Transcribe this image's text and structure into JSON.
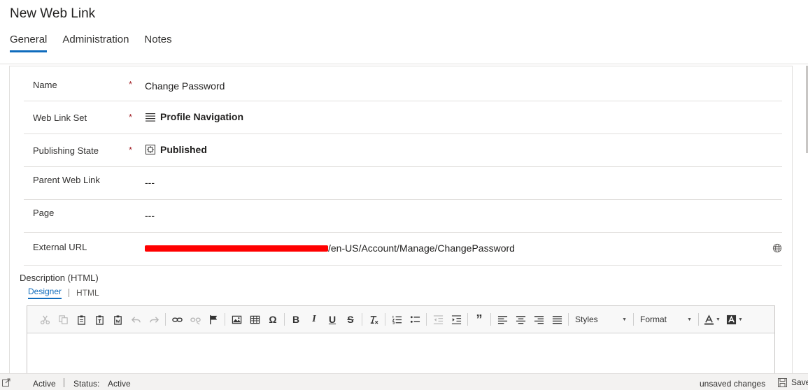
{
  "header": {
    "title": "New Web Link",
    "tabs": [
      {
        "label": "General",
        "active": true
      },
      {
        "label": "Administration",
        "active": false
      },
      {
        "label": "Notes",
        "active": false
      }
    ]
  },
  "form": {
    "fields": [
      {
        "label": "Name",
        "required": "*",
        "value": "Change Password"
      },
      {
        "label": "Web Link Set",
        "required": "*",
        "value": "Profile Navigation",
        "icon": "list-lookup-icon"
      },
      {
        "label": "Publishing State",
        "required": "*",
        "value": "Published",
        "icon": "publishing-state-icon"
      },
      {
        "label": "Parent Web Link",
        "value": "---"
      },
      {
        "label": "Page",
        "value": "---"
      },
      {
        "label": "External URL",
        "value_suffix": "/en-US/Account/Manage/ChangePassword",
        "icon": "globe-icon"
      }
    ],
    "description": {
      "label": "Description (HTML)",
      "editor_tabs": [
        {
          "label": "Designer",
          "active": true
        },
        {
          "label": "HTML",
          "active": false
        }
      ],
      "styles_label": "Styles",
      "format_label": "Format"
    }
  },
  "statusbar": {
    "record_state": "Active",
    "status_label": "Status:",
    "status_value": "Active",
    "unsaved": "unsaved changes",
    "save_label": "Save"
  },
  "colors": {
    "accent": "#0f6cbd",
    "required": "#a4262c",
    "redaction": "#ff0000"
  }
}
